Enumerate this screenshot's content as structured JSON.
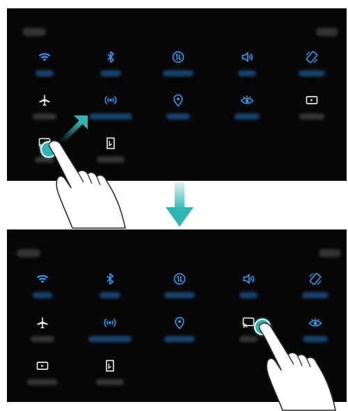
{
  "colors": {
    "active": "#2e9bf0",
    "inactive": "#e8e8e8",
    "accent": "#2fb6b4",
    "panel_bg": "#060606"
  },
  "top_panel": {
    "tiles": [
      {
        "icon": "wifi-icon",
        "active": true
      },
      {
        "icon": "bluetooth-icon",
        "active": true
      },
      {
        "icon": "mobile-data-icon",
        "active": true
      },
      {
        "icon": "sound-icon",
        "active": true
      },
      {
        "icon": "auto-rotate-icon",
        "active": true
      },
      {
        "icon": "airplane-icon",
        "active": false
      },
      {
        "icon": "hotspot-icon",
        "active": true
      },
      {
        "icon": "location-icon",
        "active": true
      },
      {
        "icon": "eye-comfort-icon",
        "active": true
      },
      {
        "icon": "screen-recorder-icon",
        "active": false
      },
      {
        "icon": "wireless-projection-icon",
        "active": false,
        "pressed": true
      },
      {
        "icon": "nfc-icon",
        "active": false
      }
    ]
  },
  "bottom_panel": {
    "tiles": [
      {
        "icon": "wifi-icon",
        "active": true
      },
      {
        "icon": "bluetooth-icon",
        "active": true
      },
      {
        "icon": "mobile-data-icon",
        "active": true
      },
      {
        "icon": "sound-icon",
        "active": true
      },
      {
        "icon": "auto-rotate-icon",
        "active": true
      },
      {
        "icon": "airplane-icon",
        "active": false
      },
      {
        "icon": "hotspot-icon",
        "active": true
      },
      {
        "icon": "location-icon",
        "active": true
      },
      {
        "icon": "wireless-projection-icon",
        "active": false,
        "pressed": true
      },
      {
        "icon": "eye-comfort-icon",
        "active": true
      },
      {
        "icon": "screen-recorder-icon",
        "active": false
      },
      {
        "icon": "nfc-icon",
        "active": false
      }
    ]
  }
}
